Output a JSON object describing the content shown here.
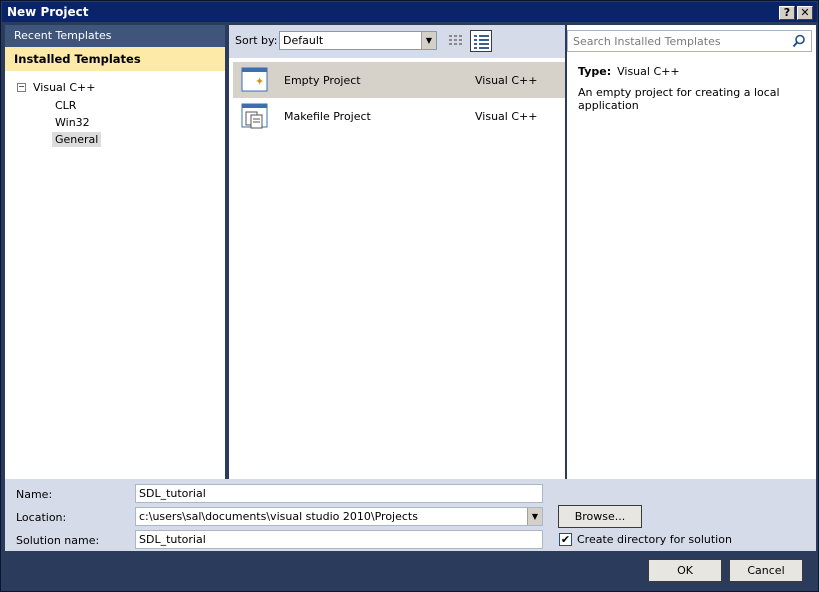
{
  "window": {
    "title": "New Project",
    "help_label": "?",
    "close_label": "✕"
  },
  "left": {
    "recent_label": "Recent Templates",
    "installed_label": "Installed Templates",
    "tree": {
      "expander": "−",
      "root": "Visual C++",
      "children": [
        "CLR",
        "Win32",
        "General"
      ],
      "selected": "General"
    }
  },
  "center": {
    "sort_label": "Sort by:",
    "sort_value": "Default",
    "templates": [
      {
        "name": "Empty Project",
        "lang": "Visual C++",
        "icon": "empty-project-icon",
        "selected": true
      },
      {
        "name": "Makefile Project",
        "lang": "Visual C++",
        "icon": "makefile-project-icon",
        "selected": false
      }
    ]
  },
  "right": {
    "search_placeholder": "Search Installed Templates",
    "type_label": "Type:",
    "type_value": "Visual C++",
    "description": "An empty project for creating a local application"
  },
  "form": {
    "name_label": "Name:",
    "name_value": "SDL_tutorial",
    "location_label": "Location:",
    "location_value": "c:\\users\\sal\\documents\\visual studio 2010\\Projects",
    "solution_label": "Solution name:",
    "solution_value": "SDL_tutorial",
    "browse_label": "Browse...",
    "create_dir_label": "Create directory for solution",
    "create_dir_checked": true
  },
  "footer": {
    "ok_label": "OK",
    "cancel_label": "Cancel"
  }
}
